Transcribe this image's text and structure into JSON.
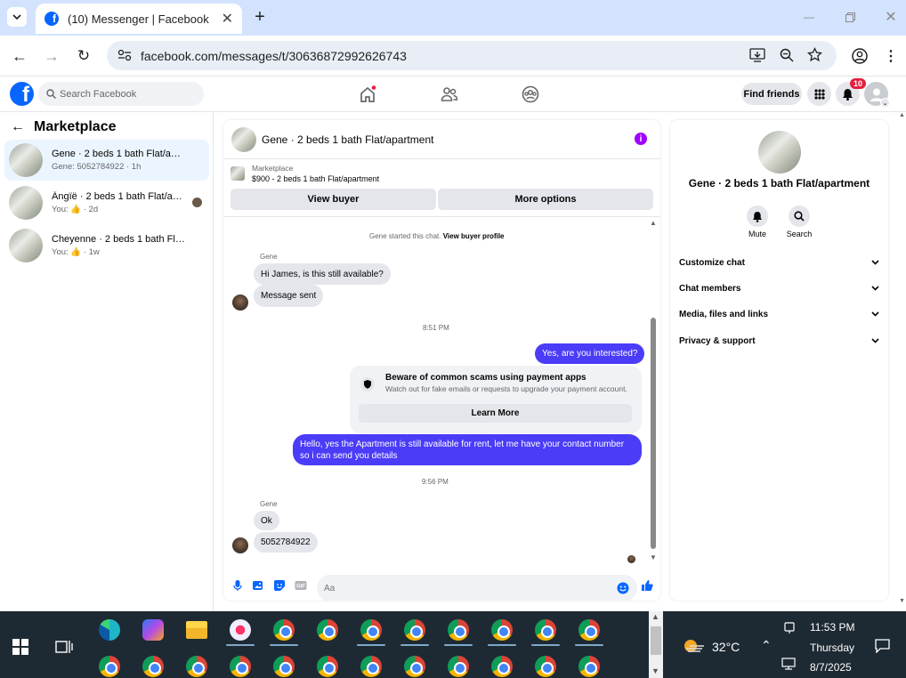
{
  "browser": {
    "tab_title": "(10) Messenger | Facebook",
    "url": "facebook.com/messages/t/30636872992626743"
  },
  "fb_header": {
    "search_placeholder": "Search Facebook",
    "find_friends": "Find friends",
    "notification_count": "10",
    "brand_color": "#0866ff"
  },
  "left_panel": {
    "title": "Marketplace",
    "conversations": [
      {
        "name": "Gene · 2 beds 1 bath Flat/apartment",
        "preview": "Gene: 5052784922 · 1h"
      },
      {
        "name": "Ängïë · 2 beds 1 bath Flat/apart...",
        "preview": "You: 👍 · 2d"
      },
      {
        "name": "Cheyenne · 2 beds 1 bath Flat/apar...",
        "preview": "You: 👍 · 1w"
      }
    ]
  },
  "chat": {
    "title": "Gene · 2 beds 1 bath Flat/apartment",
    "marketplace_label": "Marketplace",
    "listing": "$900 - 2 beds 1 bath Flat/apartment",
    "view_buyer": "View buyer",
    "more_options": "More options",
    "started_text": "Gene started this chat.",
    "view_buyer_profile": "View buyer profile",
    "sender1": "Gene",
    "msg1": "Hi James, is this still available?",
    "msg2": "Message sent",
    "time1": "8:51 PM",
    "out1": "Yes, are you interested?",
    "scam_title": "Beware of common scams using payment apps",
    "scam_sub": "Watch out for fake emails or requests to upgrade your payment account.",
    "learn_more": "Learn More",
    "out2_line1": "Hello, yes the Apartment is still available for rent, let me have your contact number",
    "out2_line2": "so i can send you details",
    "time2": "9:56 PM",
    "sender2": "Gene",
    "msg3": "Ok",
    "msg4": "5052784922",
    "input_placeholder": "Aa",
    "outgoing_color": "#4a3cf7"
  },
  "right_panel": {
    "name": "Gene · 2 beds 1 bath Flat/apartment",
    "mute": "Mute",
    "search": "Search",
    "sections": [
      "Customize chat",
      "Chat members",
      "Media, files and links",
      "Privacy & support"
    ]
  },
  "taskbar": {
    "temperature": "32°C",
    "time": "11:53 PM",
    "day": "Thursday",
    "date": "8/7/2025"
  }
}
